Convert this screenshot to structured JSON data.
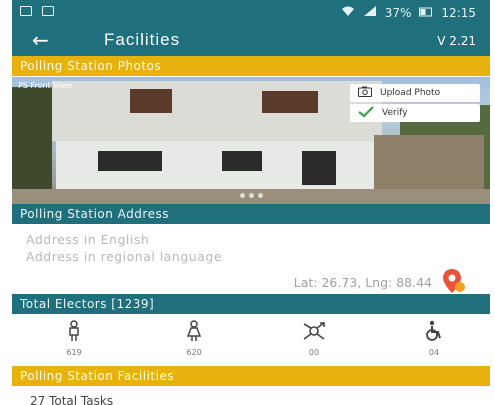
{
  "status_bar": {
    "battery": "37%",
    "time": "12:15"
  },
  "app_bar": {
    "title": "Facilities",
    "version": "V 2.21"
  },
  "sections": {
    "photos_header": "Polling Station Photos",
    "address_header": "Polling Station Address",
    "electors_header": "Total Electors [1239]",
    "facilities_header": "Polling Station Facilities"
  },
  "photo": {
    "caption": "PS Front View",
    "upload_label": "Upload Photo",
    "verify_label": "Verify"
  },
  "address": {
    "english_placeholder": "Address in English",
    "regional_placeholder": "Address in regional language",
    "latlng": "Lat: 26.73, Lng: 88.44"
  },
  "electors": [
    {
      "icon": "male-icon",
      "value": "619"
    },
    {
      "icon": "female-icon",
      "value": "620"
    },
    {
      "icon": "third-gender-icon",
      "value": "00"
    },
    {
      "icon": "wheelchair-icon",
      "value": "04"
    }
  ],
  "tasks": {
    "label": "27 Total Tasks"
  },
  "colors": {
    "primary": "#1f6f7d",
    "accent": "#e8b20e",
    "pin": "#e8533a"
  }
}
